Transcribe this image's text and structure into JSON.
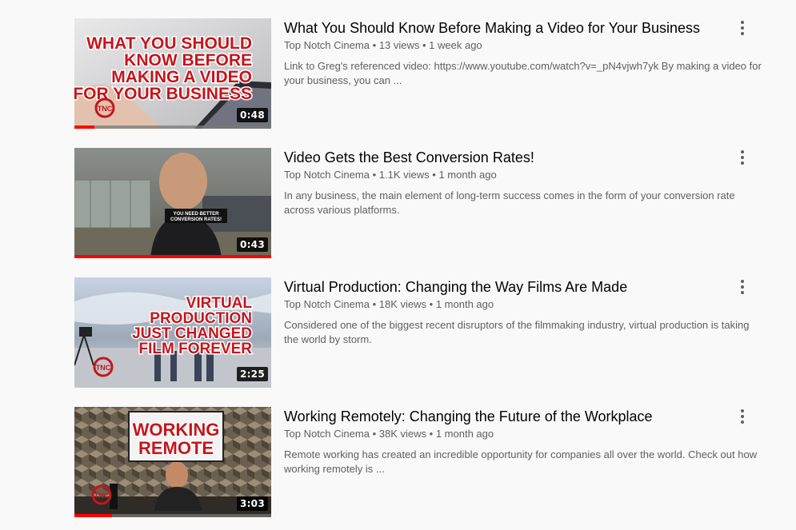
{
  "videos": [
    {
      "title": "What You Should Know Before Making a Video for Your Business",
      "channel": "Top Notch Cinema",
      "views": "13 views",
      "age": "1 week ago",
      "description": "Link to Greg's referenced video: https://www.youtube.com/watch?v=_pN4vjwh7yk By making a video for your business, you can ...",
      "duration": "0:48",
      "thumbnail_text": [
        "WHAT YOU SHOULD",
        "KNOW BEFORE",
        "MAKING A VIDEO",
        "FOR YOUR BUSINESS"
      ],
      "watched_fraction": 0.1
    },
    {
      "title": "Video Gets the Best Conversion Rates!",
      "channel": "Top Notch Cinema",
      "views": "1.1K views",
      "age": "1 month ago",
      "description": "In any business, the main element of long-term success comes in the form of your conversion rate across various platforms.",
      "duration": "0:43",
      "thumbnail_text": [
        "YOU NEED BETTER",
        "CONVERSION RATES!"
      ],
      "watched_fraction": 1.0
    },
    {
      "title": "Virtual Production: Changing the Way Films Are Made",
      "channel": "Top Notch Cinema",
      "views": "18K views",
      "age": "1 month ago",
      "description": "Considered one of the biggest recent disruptors of the filmmaking industry, virtual production is taking the world by storm.",
      "duration": "2:25",
      "thumbnail_text": [
        "VIRTUAL",
        "PRODUCTION",
        "JUST CHANGED",
        "FILM FOREVER"
      ],
      "watched_fraction": 0
    },
    {
      "title": "Working Remotely: Changing the Future of the Workplace",
      "channel": "Top Notch Cinema",
      "views": "38K views",
      "age": "1 month ago",
      "description": "Remote working has created an incredible opportunity for companies all over the world. Check out how working remotely is ...",
      "duration": "3:03",
      "thumbnail_text": [
        "WORKING",
        "REMOTE"
      ],
      "watched_fraction": 0.19
    }
  ],
  "separator": "•",
  "colors": {
    "brand_red": "#c4161c",
    "progress_red": "#ff0000",
    "meta_gray": "#606060"
  },
  "icons": {
    "menu": "more-vert-icon"
  }
}
